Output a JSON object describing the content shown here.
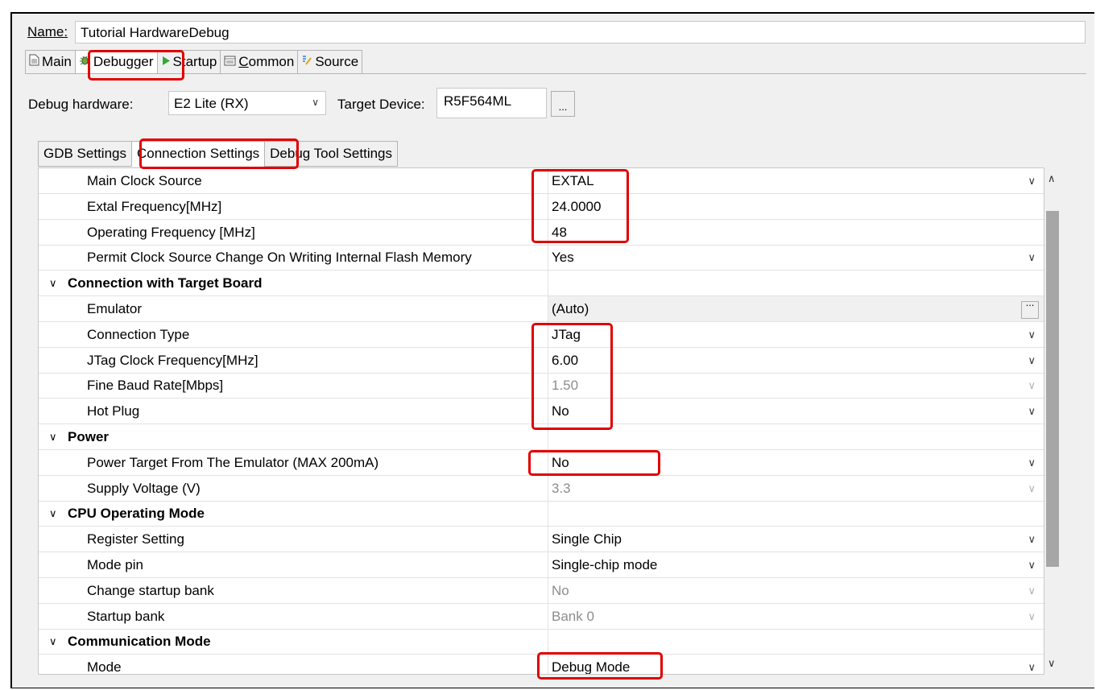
{
  "name_label": "Name:",
  "name_value": "Tutorial HardwareDebug",
  "tabs": [
    {
      "label": "Main",
      "icon": "document-icon"
    },
    {
      "label": "Debugger",
      "icon": "bug-icon"
    },
    {
      "label": "Startup",
      "icon": "play-icon"
    },
    {
      "label": "Common",
      "icon": "window-icon"
    },
    {
      "label": "Source",
      "icon": "source-icon"
    }
  ],
  "debug_hardware_label": "Debug hardware:",
  "debug_hardware_value": "E2 Lite (RX)",
  "target_device_label": "Target Device:",
  "target_device_value": "R5F564ML",
  "ellipsis": "...",
  "subtabs": [
    "GDB Settings",
    "Connection Settings",
    "Debug Tool Settings"
  ],
  "rows": [
    {
      "type": "item",
      "key": "Main Clock Source",
      "value": "EXTAL",
      "state": "enabled",
      "control": "dropdown"
    },
    {
      "type": "item",
      "key": "Extal Frequency[MHz]",
      "value": "24.0000",
      "state": "enabled",
      "control": "none"
    },
    {
      "type": "item",
      "key": "Operating Frequency [MHz]",
      "value": "48",
      "state": "enabled",
      "control": "none"
    },
    {
      "type": "item",
      "key": "Permit Clock Source Change On Writing Internal Flash Memory",
      "value": "Yes",
      "state": "enabled",
      "control": "dropdown"
    },
    {
      "type": "category",
      "key": "Connection with Target Board"
    },
    {
      "type": "item",
      "key": "Emulator",
      "value": "(Auto)",
      "state": "readonly",
      "control": "ellipsis"
    },
    {
      "type": "item",
      "key": "Connection Type",
      "value": "JTag",
      "state": "enabled",
      "control": "dropdown"
    },
    {
      "type": "item",
      "key": "JTag Clock Frequency[MHz]",
      "value": "6.00",
      "state": "enabled",
      "control": "dropdown"
    },
    {
      "type": "item",
      "key": "Fine Baud Rate[Mbps]",
      "value": "1.50",
      "state": "disabled",
      "control": "dropdown"
    },
    {
      "type": "item",
      "key": "Hot Plug",
      "value": "No",
      "state": "enabled",
      "control": "dropdown"
    },
    {
      "type": "category",
      "key": "Power"
    },
    {
      "type": "item",
      "key": "Power Target From The Emulator (MAX 200mA)",
      "value": "No",
      "state": "enabled",
      "control": "dropdown"
    },
    {
      "type": "item",
      "key": "Supply Voltage (V)",
      "value": "3.3",
      "state": "disabled",
      "control": "dropdown"
    },
    {
      "type": "category",
      "key": "CPU Operating Mode"
    },
    {
      "type": "item",
      "key": "Register Setting",
      "value": "Single Chip",
      "state": "enabled",
      "control": "dropdown"
    },
    {
      "type": "item",
      "key": "Mode pin",
      "value": "Single-chip mode",
      "state": "enabled",
      "control": "dropdown"
    },
    {
      "type": "item",
      "key": "Change startup bank",
      "value": "No",
      "state": "disabled",
      "control": "dropdown"
    },
    {
      "type": "item",
      "key": "Startup bank",
      "value": "Bank 0",
      "state": "disabled",
      "control": "dropdown"
    },
    {
      "type": "category",
      "key": "Communication Mode"
    },
    {
      "type": "item",
      "key": "Mode",
      "value": "Debug Mode",
      "state": "enabled",
      "control": "dropdown"
    }
  ],
  "highlight_color": "#e00000"
}
